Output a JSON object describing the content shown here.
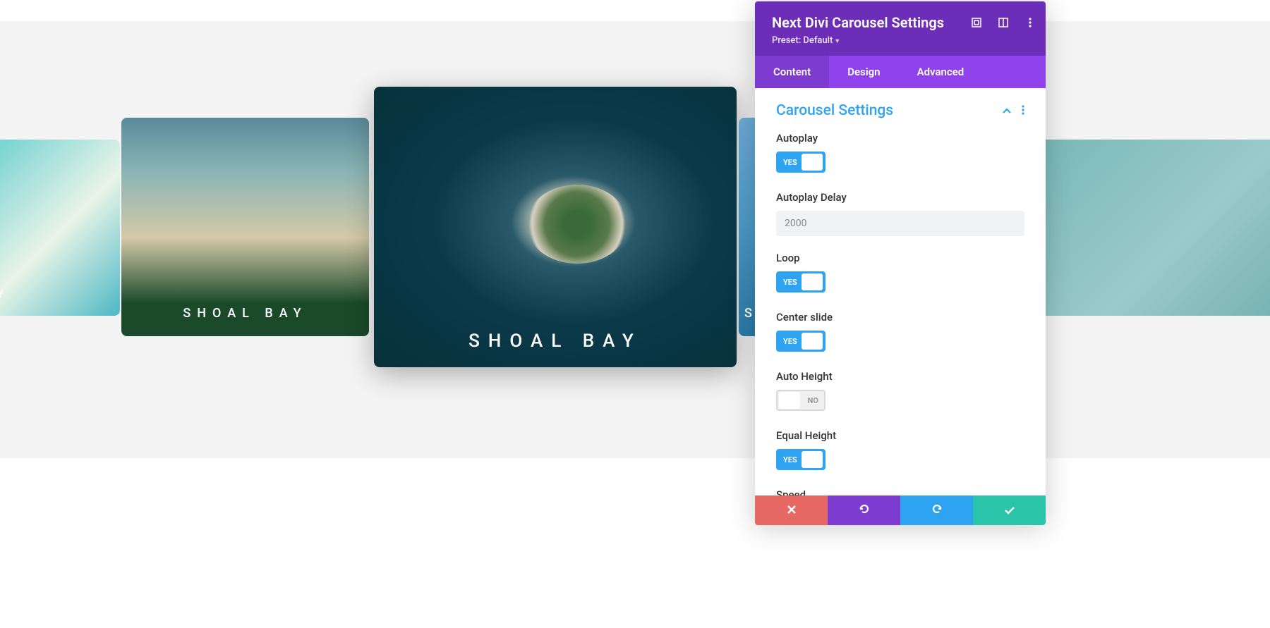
{
  "slides": {
    "far_left_label": "OAL BAY",
    "left_label": "SHOAL BAY",
    "center_label": "SHOAL BAY",
    "right_label": "SH"
  },
  "panel": {
    "title": "Next Divi Carousel Settings",
    "preset": "Preset: Default",
    "tabs": {
      "content": "Content",
      "design": "Design",
      "advanced": "Advanced"
    },
    "section_title": "Carousel Settings",
    "settings": {
      "autoplay": {
        "label": "Autoplay",
        "value": "YES"
      },
      "autoplay_delay": {
        "label": "Autoplay Delay",
        "value": "2000"
      },
      "loop": {
        "label": "Loop",
        "value": "YES"
      },
      "center_slide": {
        "label": "Center slide",
        "value": "YES"
      },
      "auto_height": {
        "label": "Auto Height",
        "value": "NO"
      },
      "equal_height": {
        "label": "Equal Height",
        "value": "YES"
      },
      "speed": {
        "label": "Speed"
      }
    }
  }
}
